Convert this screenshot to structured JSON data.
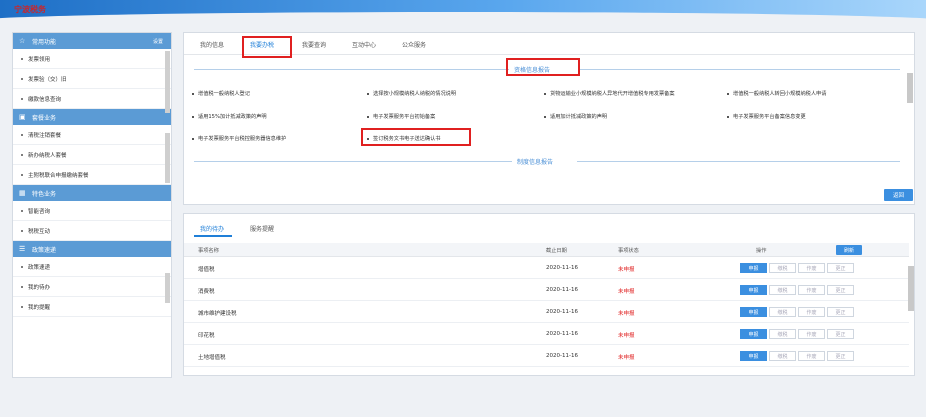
{
  "header": {
    "logo_text": "宁波税务"
  },
  "sidebar": {
    "sections": [
      {
        "title": "常用功能",
        "icon": "star-icon",
        "settings_label": "设置",
        "items": [
          "发票领用",
          "发票验（交）旧",
          "缴款信息查询"
        ]
      },
      {
        "title": "套餐业务",
        "icon": "package-icon",
        "items": [
          "清税注销套餐",
          "新办纳税人套餐",
          "主附税联合申报缴纳套餐"
        ]
      },
      {
        "title": "特色业务",
        "icon": "grid-icon",
        "items": [
          "智能咨询",
          "税税互动"
        ]
      },
      {
        "title": "政策速递",
        "icon": "list-icon",
        "items": [
          "政策速递",
          "我的待办",
          "我的提醒"
        ]
      }
    ]
  },
  "top_panel": {
    "tabs": [
      "我的信息",
      "我要办税",
      "我要查询",
      "互动中心",
      "公众服务"
    ],
    "active_tab": 1,
    "section1_title": "资格信息报告",
    "links": [
      "增值税一般纳税人登记",
      "选择按小规模纳税人纳税的情况说明",
      "货物运输业小规模纳税人异地代开增值税专用发票备案",
      "增值税一般纳税人转回小规模纳税人申请",
      "适用15%加计抵减政策的声明",
      "电子发票服务平台初始备案",
      "适用加计抵减政策的声明",
      "电子发票服务平台备案信息变更",
      "电子发票服务平台税控服务器信息维护",
      "签订税务文书电子送达确认书"
    ],
    "section2_title": "制度信息报告",
    "back_button": "返回"
  },
  "todo_panel": {
    "tabs": [
      "我的待办",
      "服务提醒"
    ],
    "headers": {
      "name": "事项名称",
      "deadline": "截止日期",
      "status": "事项状态",
      "ops": "操作"
    },
    "refresh_label": "刷新",
    "op_labels": [
      "申报",
      "缴税",
      "作废",
      "更正"
    ],
    "rows": [
      {
        "name": "增值税",
        "deadline": "2020-11-16",
        "status": "未申报"
      },
      {
        "name": "消费税",
        "deadline": "2020-11-16",
        "status": "未申报"
      },
      {
        "name": "城市维护建设税",
        "deadline": "2020-11-16",
        "status": "未申报"
      },
      {
        "name": "印花税",
        "deadline": "2020-11-16",
        "status": "未申报"
      },
      {
        "name": "土地增值税",
        "deadline": "2020-11-16",
        "status": "未申报"
      }
    ]
  },
  "colors": {
    "accent": "#3b8fe0",
    "highlight_box": "#e02020",
    "sidebar_header": "#5b9bd5"
  }
}
